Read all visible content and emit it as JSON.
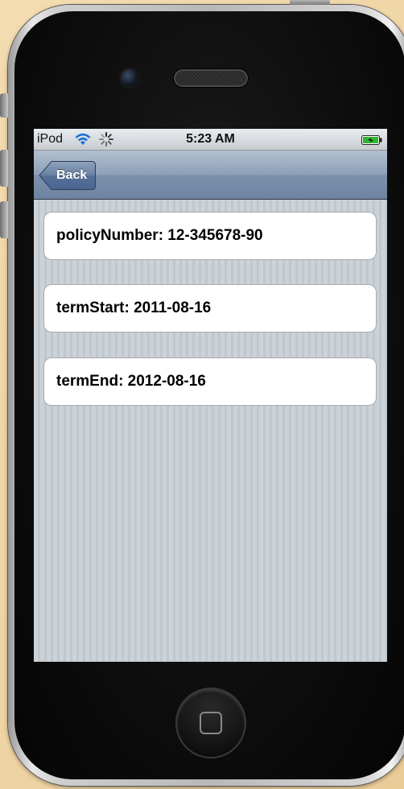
{
  "status_bar": {
    "carrier": "iPod",
    "time": "5:23 AM",
    "wifi_icon": "wifi-icon",
    "activity_icon": "activity-spinner-icon",
    "battery_icon": "battery-charging-icon"
  },
  "nav_bar": {
    "back_label": "Back"
  },
  "rows": [
    {
      "label": "policyNumber: 12-345678-90"
    },
    {
      "label": "termStart: 2011-08-16"
    },
    {
      "label": "termEnd: 2012-08-16"
    }
  ],
  "colors": {
    "background": "#f0d6a6",
    "nav_bar": "#8d9fb7",
    "content_bg": "#c5ccd4",
    "row_bg": "#ffffff"
  }
}
